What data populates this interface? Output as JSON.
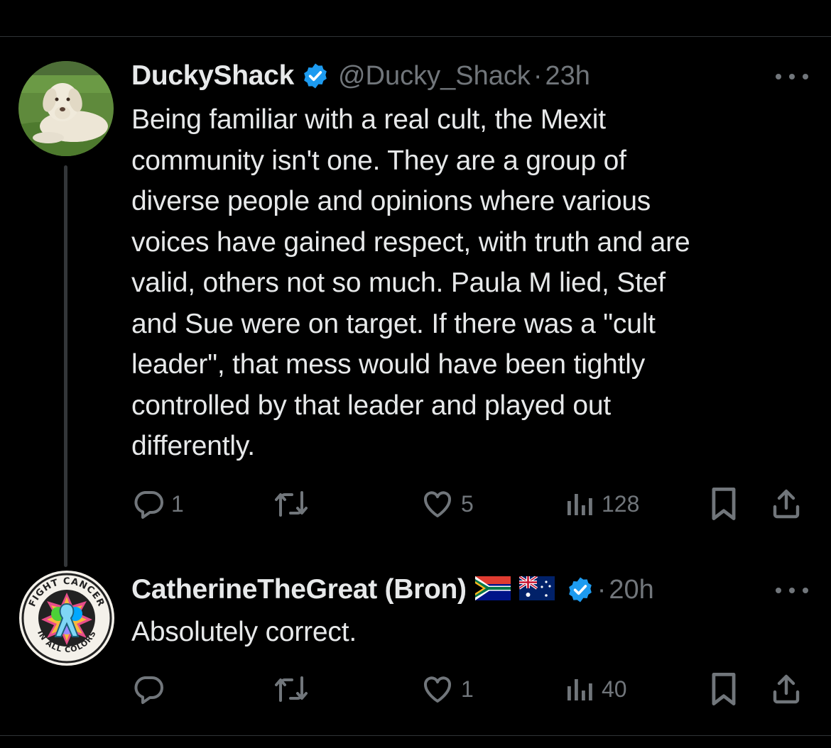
{
  "tweets": [
    {
      "display_name": "DuckyShack",
      "handle": "@Ducky_Shack",
      "separator": "·",
      "time": "23h",
      "text_lines": [
        "Being familiar with a real cult, the Mexit",
        "community isn't one.  They are a group of",
        "diverse people and opinions where various",
        "voices have gained respect, with truth and are",
        "valid, others not so much.  Paula M lied, Stef",
        "and Sue were on target.  If there was a \"cult",
        "leader\", that mess would have been tightly",
        "controlled by that leader and played out",
        "differently."
      ],
      "replies": "1",
      "reposts": "",
      "likes": "5",
      "views": "128",
      "avatar_icon": "white-dog-avatar-icon"
    },
    {
      "display_name": "CatherineTheGreat (Bron)",
      "handle": "",
      "flags": [
        "south-africa-flag-icon",
        "australia-flag-icon"
      ],
      "separator": "·",
      "time": "20h",
      "text_lines": [
        "Absolutely correct."
      ],
      "replies": "",
      "reposts": "",
      "likes": "1",
      "views": "40",
      "avatar_icon": "fight-cancer-ribbon-avatar-icon",
      "avatar_text_top": "FIGHT CANCER",
      "avatar_text_bottom": "IN ALL COLORS"
    }
  ],
  "colors": {
    "background": "#000000",
    "text": "#e7e9ea",
    "muted": "#71767b",
    "verified": "#1d9bf0",
    "divider": "#2f3336"
  }
}
